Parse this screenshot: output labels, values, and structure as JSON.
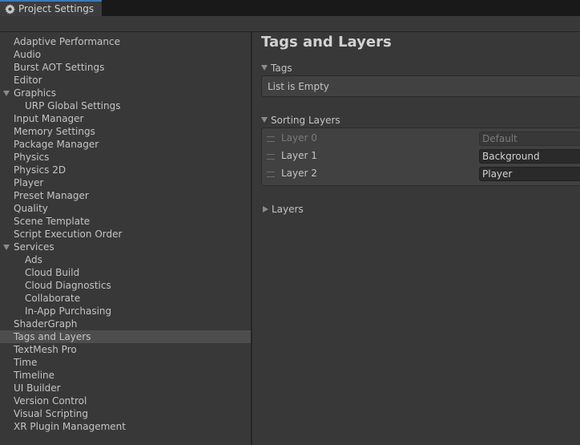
{
  "window": {
    "tab_title": "Project Settings",
    "tab_icon": "gear-icon"
  },
  "sidebar": {
    "items": [
      {
        "label": "Adaptive Performance",
        "level": 0
      },
      {
        "label": "Audio",
        "level": 0
      },
      {
        "label": "Burst AOT Settings",
        "level": 0
      },
      {
        "label": "Editor",
        "level": 0
      },
      {
        "label": "Graphics",
        "level": 0,
        "expanded": true
      },
      {
        "label": "URP Global Settings",
        "level": 1
      },
      {
        "label": "Input Manager",
        "level": 0
      },
      {
        "label": "Memory Settings",
        "level": 0
      },
      {
        "label": "Package Manager",
        "level": 0
      },
      {
        "label": "Physics",
        "level": 0
      },
      {
        "label": "Physics 2D",
        "level": 0
      },
      {
        "label": "Player",
        "level": 0
      },
      {
        "label": "Preset Manager",
        "level": 0
      },
      {
        "label": "Quality",
        "level": 0
      },
      {
        "label": "Scene Template",
        "level": 0
      },
      {
        "label": "Script Execution Order",
        "level": 0
      },
      {
        "label": "Services",
        "level": 0,
        "expanded": true
      },
      {
        "label": "Ads",
        "level": 1
      },
      {
        "label": "Cloud Build",
        "level": 1
      },
      {
        "label": "Cloud Diagnostics",
        "level": 1
      },
      {
        "label": "Collaborate",
        "level": 1
      },
      {
        "label": "In-App Purchasing",
        "level": 1
      },
      {
        "label": "ShaderGraph",
        "level": 0
      },
      {
        "label": "Tags and Layers",
        "level": 0,
        "selected": true
      },
      {
        "label": "TextMesh Pro",
        "level": 0
      },
      {
        "label": "Time",
        "level": 0
      },
      {
        "label": "Timeline",
        "level": 0
      },
      {
        "label": "UI Builder",
        "level": 0
      },
      {
        "label": "Version Control",
        "level": 0
      },
      {
        "label": "Visual Scripting",
        "level": 0
      },
      {
        "label": "XR Plugin Management",
        "level": 0
      }
    ]
  },
  "main": {
    "title": "Tags and Layers",
    "tags": {
      "label": "Tags",
      "empty_text": "List is Empty"
    },
    "sorting_layers": {
      "label": "Sorting Layers",
      "rows": [
        {
          "name": "Layer 0",
          "value": "Default",
          "disabled": true
        },
        {
          "name": "Layer 1",
          "value": "Background",
          "disabled": false
        },
        {
          "name": "Layer 2",
          "value": "Player",
          "disabled": false
        }
      ]
    },
    "layers": {
      "label": "Layers"
    }
  },
  "colors": {
    "accent": "#3a79bb",
    "panel": "#383838",
    "selected_row": "#4d4d4d"
  }
}
